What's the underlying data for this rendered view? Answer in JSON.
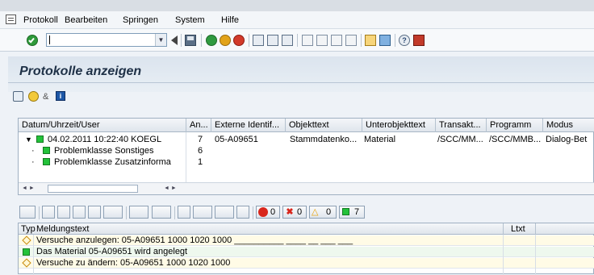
{
  "menubar": {
    "items": [
      "Protokoll",
      "Bearbeiten",
      "Springen",
      "System",
      "Hilfe"
    ]
  },
  "toolbar": {
    "command_value": ""
  },
  "page": {
    "title": "Protokolle anzeigen"
  },
  "tree": {
    "columns": [
      "Datum/Uhrzeit/User",
      "An...",
      "Externe Identif...",
      "Objekttext",
      "Unterobjekttext",
      "Transakt...",
      "Programm",
      "Modus"
    ],
    "rows": [
      {
        "expander": "▼",
        "label": "04.02.2011  10:22:40  KOEGL",
        "count": "7",
        "extid": "05-A09651",
        "objtext": "Stammdatenko...",
        "subobj": "Material",
        "transakt": "/SCC/MM...",
        "programm": "/SCC/MMB...",
        "modus": "Dialog-Bet"
      },
      {
        "expander": "·",
        "label": "Problemklasse Sonstiges",
        "count": "6"
      },
      {
        "expander": "·",
        "label": "Problemklasse Zusatzinforma",
        "count": "1"
      }
    ]
  },
  "list": {
    "counts": {
      "stop": "0",
      "error": "0",
      "warning": "0",
      "success": "7"
    },
    "columns": [
      "Typ",
      "Meldungstext",
      "Ltxt"
    ],
    "rows": [
      {
        "type": "warning",
        "text": "Versuche anzulegen: 05-A09651 1000 1020 1000 __________ ____ __ ___ ___"
      },
      {
        "type": "success",
        "text": "Das Material 05-A09651 wird angelegt"
      },
      {
        "type": "warning",
        "text": "Versuche zu ändern: 05-A09651 1000 1020 1000"
      }
    ]
  },
  "colors": {
    "success": "#23c23a",
    "warning": "#e8a000",
    "error": "#d8261c"
  }
}
